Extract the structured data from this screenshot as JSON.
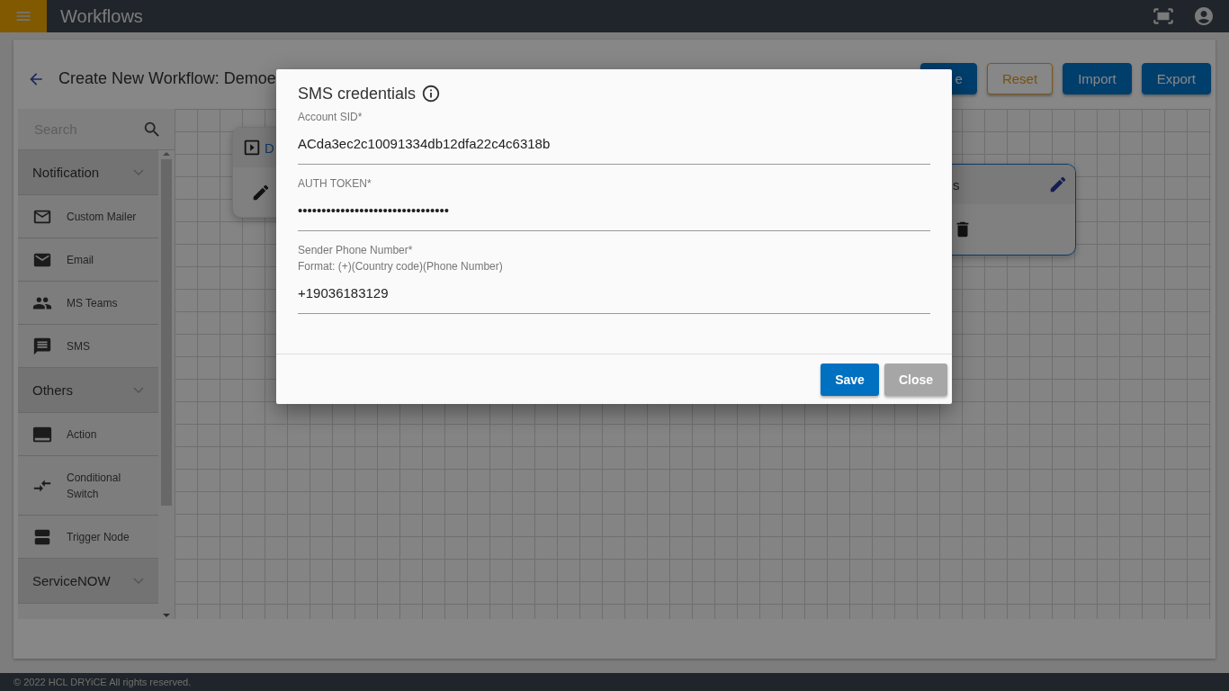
{
  "app": {
    "title": "Workflows"
  },
  "page": {
    "title": "Create New Workflow: Demoe",
    "buttons": [
      {
        "label": "e",
        "kind": "primary"
      },
      {
        "label": "Reset",
        "kind": "outline"
      },
      {
        "label": "Import",
        "kind": "primary"
      },
      {
        "label": "Export",
        "kind": "primary"
      }
    ]
  },
  "palette": {
    "search": {
      "placeholder": "Search"
    },
    "groups": [
      {
        "label": "Notification",
        "items": [
          {
            "label": "Custom Mailer",
            "kind": "mailer"
          },
          {
            "label": "Email",
            "kind": "email"
          },
          {
            "label": "MS Teams",
            "kind": "teams"
          },
          {
            "label": "SMS",
            "kind": "sms"
          }
        ]
      },
      {
        "label": "Others",
        "items": [
          {
            "label": "Action",
            "kind": "action"
          },
          {
            "label": "Conditional Switch",
            "kind": "switch"
          },
          {
            "label": "Trigger Node",
            "kind": "trigger"
          }
        ]
      },
      {
        "label": "ServiceNOW"
      }
    ]
  },
  "canvas": {
    "nodes": [
      {
        "title": "D",
        "kind": "trigger"
      },
      {
        "title": "s",
        "kind": "sms"
      }
    ]
  },
  "dialog": {
    "title": "SMS credentials",
    "fields": [
      {
        "label": "Account SID*",
        "value": "ACda3ec2c10091334db12dfa22c4c6318b"
      },
      {
        "label": "AUTH TOKEN*",
        "value": "••••••••••••••••••••••••••••••••"
      },
      {
        "label": "Sender Phone Number*",
        "hint": "Format: (+)(Country code)(Phone Number)",
        "value": "+19036183129"
      }
    ],
    "buttons": [
      {
        "label": "Save",
        "kind": "primary"
      },
      {
        "label": "Close",
        "kind": "secondary"
      }
    ]
  },
  "footer": {
    "text": "© 2022 HCL DRYiCE All rights reserved."
  }
}
